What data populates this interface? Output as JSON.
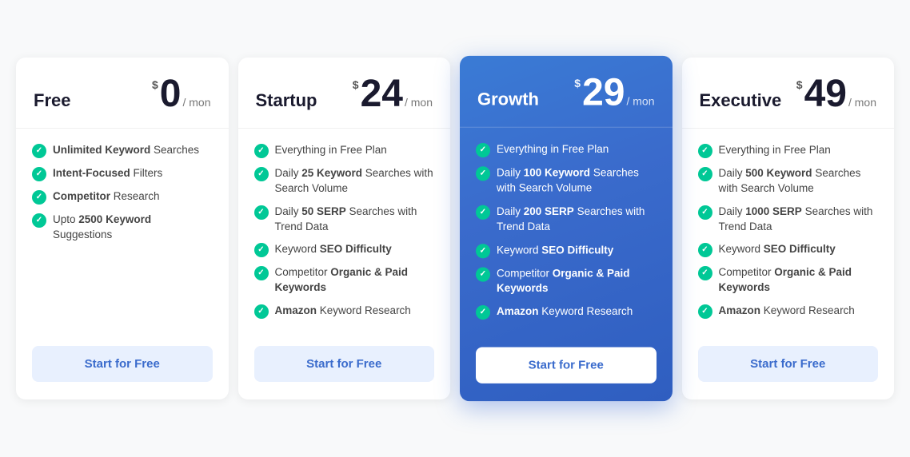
{
  "plans": [
    {
      "id": "free",
      "name": "Free",
      "currency": "$",
      "price": "0",
      "period": "/ mon",
      "featured": false,
      "features": [
        {
          "html": "<b>Unlimited Keyword</b> Searches"
        },
        {
          "html": "<b>Intent-Focused</b> Filters"
        },
        {
          "html": "<b>Competitor</b> Research"
        },
        {
          "html": "Upto <b>2500 Keyword</b> Suggestions"
        }
      ],
      "cta": "Start for Free"
    },
    {
      "id": "startup",
      "name": "Startup",
      "currency": "$",
      "price": "24",
      "period": "/ mon",
      "featured": false,
      "features": [
        {
          "html": "Everything in Free Plan"
        },
        {
          "html": "Daily <b>25 Keyword</b> Searches with Search Volume"
        },
        {
          "html": "Daily <b>50 SERP</b> Searches with Trend Data"
        },
        {
          "html": "Keyword <b>SEO Difficulty</b>"
        },
        {
          "html": "Competitor <b>Organic & Paid Keywords</b>"
        },
        {
          "html": "<b>Amazon</b> Keyword Research"
        }
      ],
      "cta": "Start for Free"
    },
    {
      "id": "growth",
      "name": "Growth",
      "currency": "$",
      "price": "29",
      "period": "/ mon",
      "featured": true,
      "features": [
        {
          "html": "Everything in Free Plan"
        },
        {
          "html": "Daily <b>100 Keyword</b> Searches with Search Volume"
        },
        {
          "html": "Daily <b>200 SERP</b> Searches with Trend Data"
        },
        {
          "html": "Keyword <b>SEO Difficulty</b>"
        },
        {
          "html": "Competitor <b>Organic & Paid Keywords</b>"
        },
        {
          "html": "<b>Amazon</b> Keyword Research"
        }
      ],
      "cta": "Start for Free"
    },
    {
      "id": "executive",
      "name": "Executive",
      "currency": "$",
      "price": "49",
      "period": "/ mon",
      "featured": false,
      "features": [
        {
          "html": "Everything in Free Plan"
        },
        {
          "html": "Daily <b>500 Keyword</b> Searches with Search Volume"
        },
        {
          "html": "Daily <b>1000 SERP</b> Searches with Trend Data"
        },
        {
          "html": "Keyword <b>SEO Difficulty</b>"
        },
        {
          "html": "Competitor <b>Organic & Paid Keywords</b>"
        },
        {
          "html": "<b>Amazon</b> Keyword Research"
        }
      ],
      "cta": "Start for Free"
    }
  ]
}
